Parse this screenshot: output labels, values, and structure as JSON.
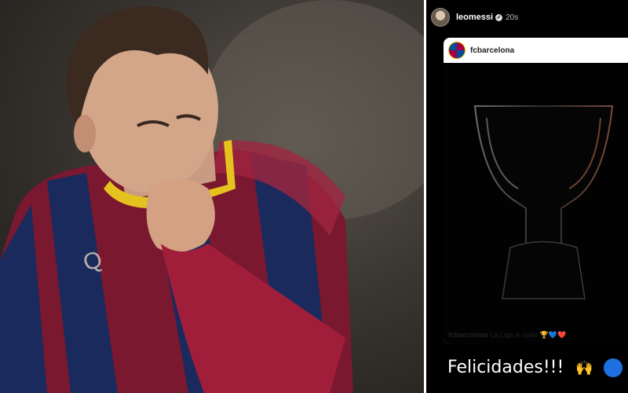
{
  "story": {
    "username": "leomessi",
    "time": "20s",
    "post": {
      "username": "fcbarcelona",
      "caption_user": "fcbarcelona",
      "caption_text": "La Liga is culer 🏆💙❤️"
    },
    "message": "Felicidades!!!",
    "emoji": "🙌"
  },
  "colors": {
    "barca_blue": "#004d98",
    "barca_red": "#a50044",
    "barca_gold": "#edbb00",
    "story_bg": "#000000"
  }
}
